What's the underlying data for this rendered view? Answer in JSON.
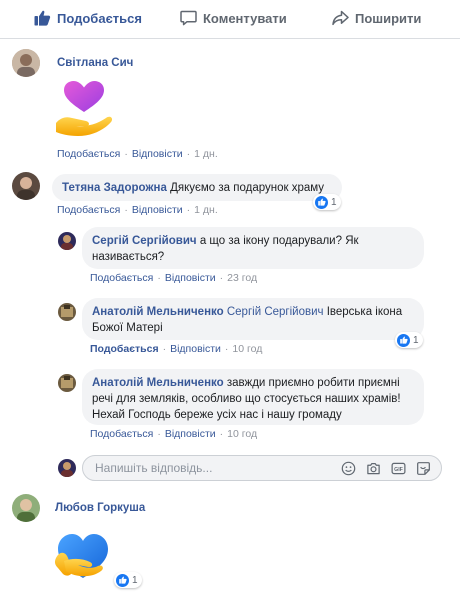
{
  "action_bar": {
    "like": "Подобається",
    "comment": "Коментувати",
    "share": "Поширити"
  },
  "comments": {
    "c1": {
      "author": "Світлана Сич",
      "sticker": "heart-in-hand-sticker",
      "like": "Подобається",
      "reply": "Відповісти",
      "time": "1 дн."
    },
    "c2": {
      "author": "Тетяна Задорожна",
      "text": "Дякуємо за подарунок храму",
      "like": "Подобається",
      "reply": "Відповісти",
      "time": "1 дн.",
      "reactions": "1"
    },
    "r1": {
      "author": "Сергій Сергійович",
      "text": "а що за ікону подарували? Як називається?",
      "like": "Подобається",
      "reply": "Відповісти",
      "time": "23 год"
    },
    "r2": {
      "author": "Анатолій Мельниченко",
      "mention": "Сергій Сергійович",
      "text": "Іверська ікона Божої Матері",
      "like": "Подобається",
      "reply": "Відповісти",
      "time": "10 год",
      "reactions": "1"
    },
    "r3": {
      "author": "Анатолій Мельниченко",
      "text": "завжди приємно робити приємні речі для земляків, особливо що стосується наших храмів! Нехай Господь береже усіх нас і нашу громаду",
      "like": "Подобається",
      "reply": "Відповісти",
      "time": "10 год"
    },
    "c3": {
      "author": "Любов Горкуша",
      "sticker": "heart-hug-sticker",
      "reactions": "1"
    }
  },
  "reply_input": {
    "placeholder": "Напишіть відповідь..."
  },
  "icons": [
    "thumbs-up-icon",
    "comment-icon",
    "share-icon",
    "emoji-icon",
    "camera-icon",
    "gif-icon",
    "sticker-icon",
    "like-badge-icon"
  ],
  "colors": {
    "link": "#385898",
    "meta": "#606770",
    "bubble": "#f2f3f5",
    "like_blue": "#1877f2"
  }
}
